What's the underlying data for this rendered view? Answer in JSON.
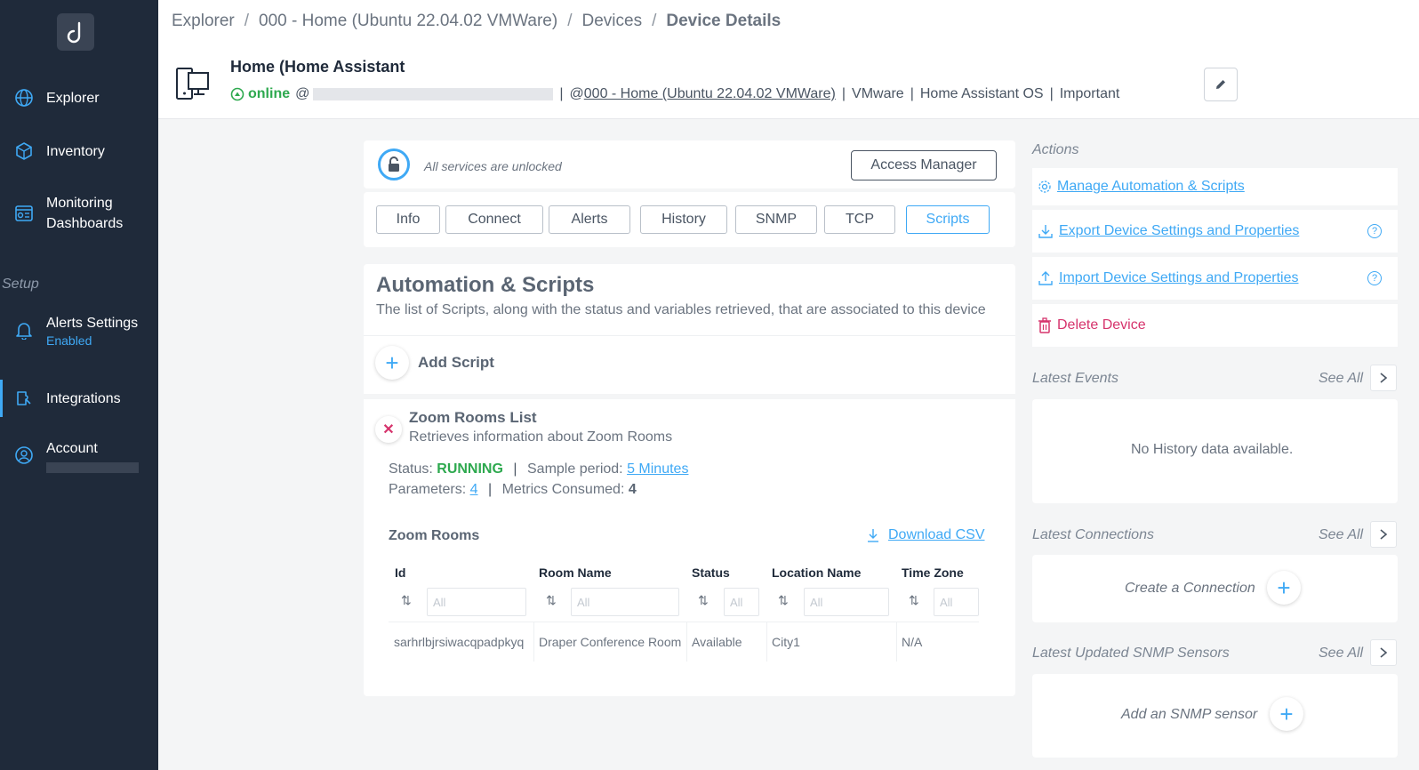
{
  "sidebar": {
    "items": [
      {
        "label": "Explorer",
        "icon": "globe-icon"
      },
      {
        "label": "Inventory",
        "icon": "cube-icon"
      },
      {
        "label_line1": "Monitoring",
        "label_line2": "Dashboards",
        "icon": "dashboard-icon"
      },
      {
        "label": "Alerts Settings",
        "sub": "Enabled",
        "icon": "bell-icon"
      },
      {
        "label": "Integrations",
        "icon": "integrations-icon"
      },
      {
        "label": "Account",
        "icon": "user-icon"
      }
    ],
    "setup_label": "Setup"
  },
  "breadcrumb": {
    "items": [
      "Explorer",
      "000 - Home (Ubuntu 22.04.02 VMWare)",
      "Devices"
    ],
    "current": "Device Details",
    "separator": "/"
  },
  "device": {
    "title": "Home (Home Assistant",
    "status": "online",
    "at": "@",
    "network_link": "000 - Home (Ubuntu 22.04.02 VMWare)",
    "vendor": "VMware",
    "os": "Home Assistant OS",
    "tag": "Important"
  },
  "lock": {
    "text": "All services are unlocked",
    "access_button": "Access Manager"
  },
  "tabs": [
    "Info",
    "Connect",
    "Alerts",
    "History",
    "SNMP",
    "TCP",
    "Scripts"
  ],
  "scripts": {
    "title": "Automation & Scripts",
    "description": "The list of Scripts, along with the status and variables retrieved, that are associated to this device",
    "add_label": "Add Script",
    "script": {
      "name": "Zoom Rooms List",
      "description": "Retrieves information about Zoom Rooms",
      "status_label": "Status:",
      "status_value": "RUNNING",
      "sample_label": "Sample period:",
      "sample_value": "5 Minutes",
      "params_label": "Parameters:",
      "params_value": "4",
      "metrics_label": "Metrics Consumed:",
      "metrics_value": "4"
    },
    "table": {
      "title": "Zoom Rooms",
      "download": "Download CSV",
      "filter_placeholder": "All",
      "columns": [
        "Id",
        "Room Name",
        "Status",
        "Location Name",
        "Time Zone"
      ],
      "rows": [
        [
          "sarhrlbjrsiwacqpadpkyq",
          "Draper Conference Room",
          "Available",
          "City1",
          "N/A"
        ]
      ]
    }
  },
  "actions": {
    "label": "Actions",
    "manage": "Manage Automation & Scripts",
    "export": "Export Device Settings and Properties",
    "import": "Import Device Settings and Properties",
    "delete": "Delete Device"
  },
  "latest_events": {
    "label": "Latest Events",
    "see_all": "See All",
    "empty": "No History data available."
  },
  "latest_connections": {
    "label": "Latest Connections",
    "see_all": "See All",
    "create": "Create a Connection"
  },
  "latest_snmp": {
    "label": "Latest Updated SNMP Sensors",
    "see_all": "See All",
    "add": "Add an SNMP sensor"
  },
  "colors": {
    "sidebar_bg": "#1f2a3a",
    "accent": "#3fa9f5",
    "online": "#2ea94f",
    "danger": "#d6336c"
  }
}
